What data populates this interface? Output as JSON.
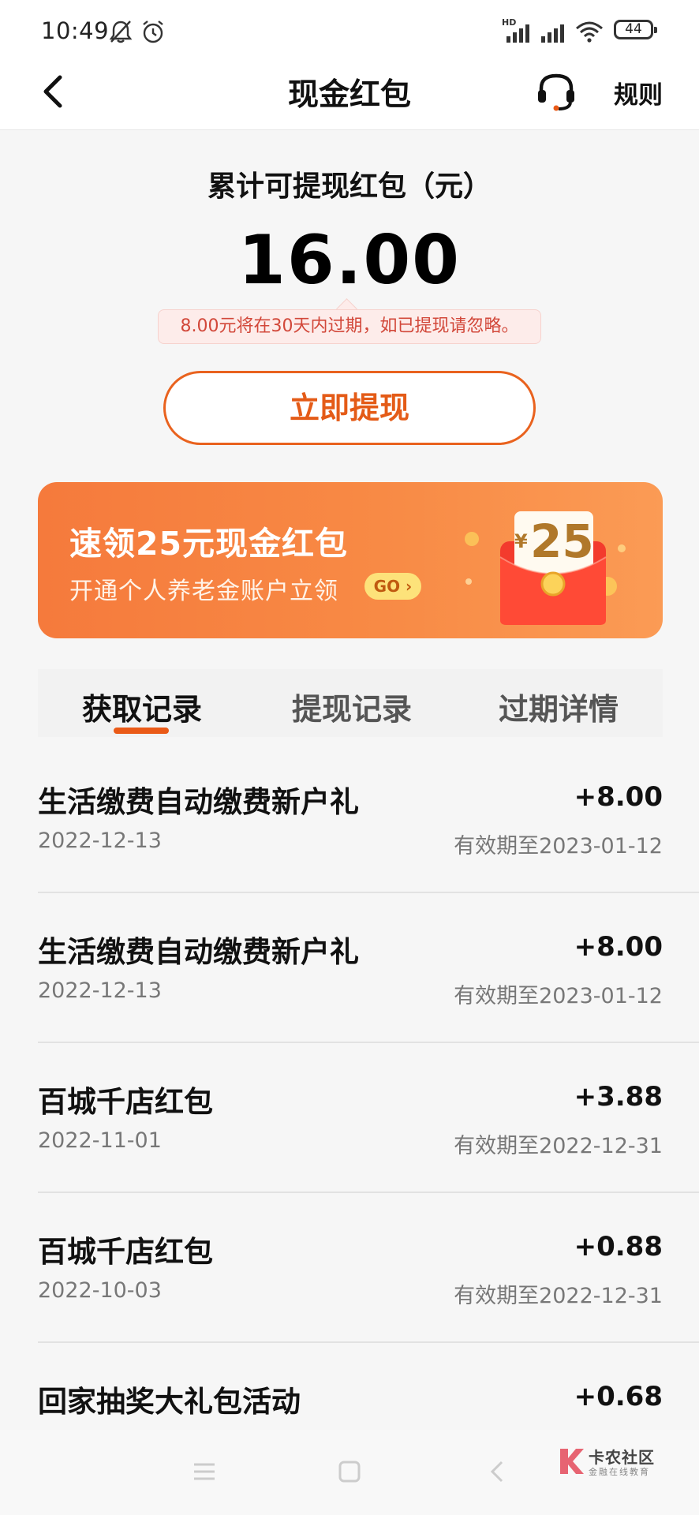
{
  "status_bar": {
    "time": "10:49",
    "battery": "44",
    "network": "HD"
  },
  "header": {
    "title": "现金红包",
    "rules_label": "规则"
  },
  "balance": {
    "label": "累计可提现红包（元）",
    "amount": "16.00",
    "notice": "8.00元将在30天内过期，如已提现请忽略。",
    "withdraw_label": "立即提现"
  },
  "promo": {
    "title": "速领25元现金红包",
    "subtitle": "开通个人养老金账户立领",
    "go_label": "GO",
    "envelope_amount": "25",
    "envelope_currency": "¥"
  },
  "tabs": [
    {
      "label": "获取记录",
      "active": true
    },
    {
      "label": "提现记录",
      "active": false
    },
    {
      "label": "过期详情",
      "active": false
    }
  ],
  "records": [
    {
      "title": "生活缴费自动缴费新户礼",
      "date": "2022-12-13",
      "amount": "+8.00",
      "expiry": "有效期至2023-01-12"
    },
    {
      "title": "生活缴费自动缴费新户礼",
      "date": "2022-12-13",
      "amount": "+8.00",
      "expiry": "有效期至2023-01-12"
    },
    {
      "title": "百城千店红包",
      "date": "2022-11-01",
      "amount": "+3.88",
      "expiry": "有效期至2022-12-31"
    },
    {
      "title": "百城千店红包",
      "date": "2022-10-03",
      "amount": "+0.88",
      "expiry": "有效期至2022-12-31"
    },
    {
      "title": "回家抽奖大礼包活动",
      "amount": "+0.68"
    }
  ],
  "watermark": {
    "name": "卡农社区",
    "tagline": "金融在线教育"
  },
  "colors": {
    "accent": "#e9621e",
    "banner_start": "#f57a3c",
    "notice_bg": "#fdecea"
  }
}
